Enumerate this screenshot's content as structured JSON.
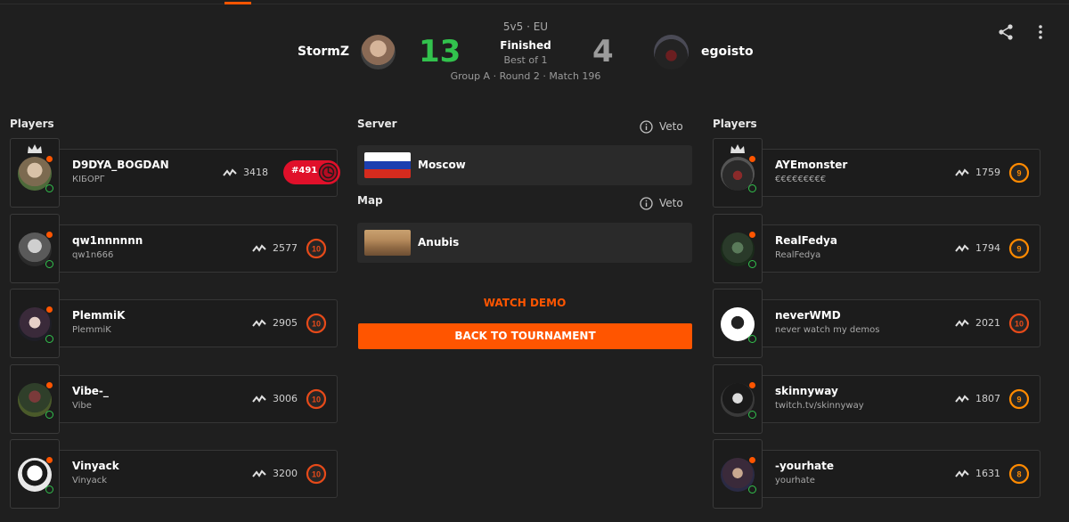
{
  "match": {
    "mode": "5v5 · EU",
    "status": "Finished",
    "best_of": "Best of 1",
    "group_info": "Group A · Round 2 · Match 196"
  },
  "team1": {
    "name": "StormZ",
    "score": "13",
    "score_color": "#32c24d"
  },
  "team2": {
    "name": "egoisto",
    "score": "4",
    "score_color": "#9b9b9b"
  },
  "header_icons": [
    "share-icon",
    "more-vertical-icon"
  ],
  "left_players": {
    "label": "Players",
    "items": [
      {
        "name": "D9DYA_BOGDAN",
        "sub": "КІБОРГ",
        "elo": "3418",
        "level": "",
        "rank": "#491",
        "captain": true
      },
      {
        "name": "qw1nnnnnn",
        "sub": "qw1n666",
        "elo": "2577",
        "level": "10"
      },
      {
        "name": "PlemmiK",
        "sub": "PlemmiK",
        "elo": "2905",
        "level": "10"
      },
      {
        "name": "Vibe-_",
        "sub": "Vibe",
        "elo": "3006",
        "level": "10"
      },
      {
        "name": "Vinyack",
        "sub": "Vinyack",
        "elo": "3200",
        "level": "10"
      }
    ]
  },
  "right_players": {
    "label": "Players",
    "items": [
      {
        "name": "AYEmonster",
        "sub": "€€€€€€€€€",
        "elo": "1759",
        "level": "9",
        "captain": true
      },
      {
        "name": "RealFedya",
        "sub": "RealFedya",
        "elo": "1794",
        "level": "9"
      },
      {
        "name": "neverWMD",
        "sub": "never watch my demos",
        "elo": "2021",
        "level": "10"
      },
      {
        "name": "skinnyway",
        "sub": "twitch.tv/skinnyway",
        "elo": "1807",
        "level": "9"
      },
      {
        "name": "-yourhate",
        "sub": "yourhate",
        "elo": "1631",
        "level": "8"
      }
    ]
  },
  "server": {
    "label": "Server",
    "value": "Moscow",
    "veto_label": "Veto"
  },
  "map": {
    "label": "Map",
    "value": "Anubis",
    "veto_label": "Veto"
  },
  "actions": {
    "watch_demo": "WATCH DEMO",
    "back_to_tournament": "BACK TO TOURNAMENT"
  },
  "colors": {
    "accent": "#ff5500",
    "win": "#32c24d",
    "rank_red": "#e0102a",
    "level10": "#e64a19",
    "level8_9": "#ff8a00"
  }
}
